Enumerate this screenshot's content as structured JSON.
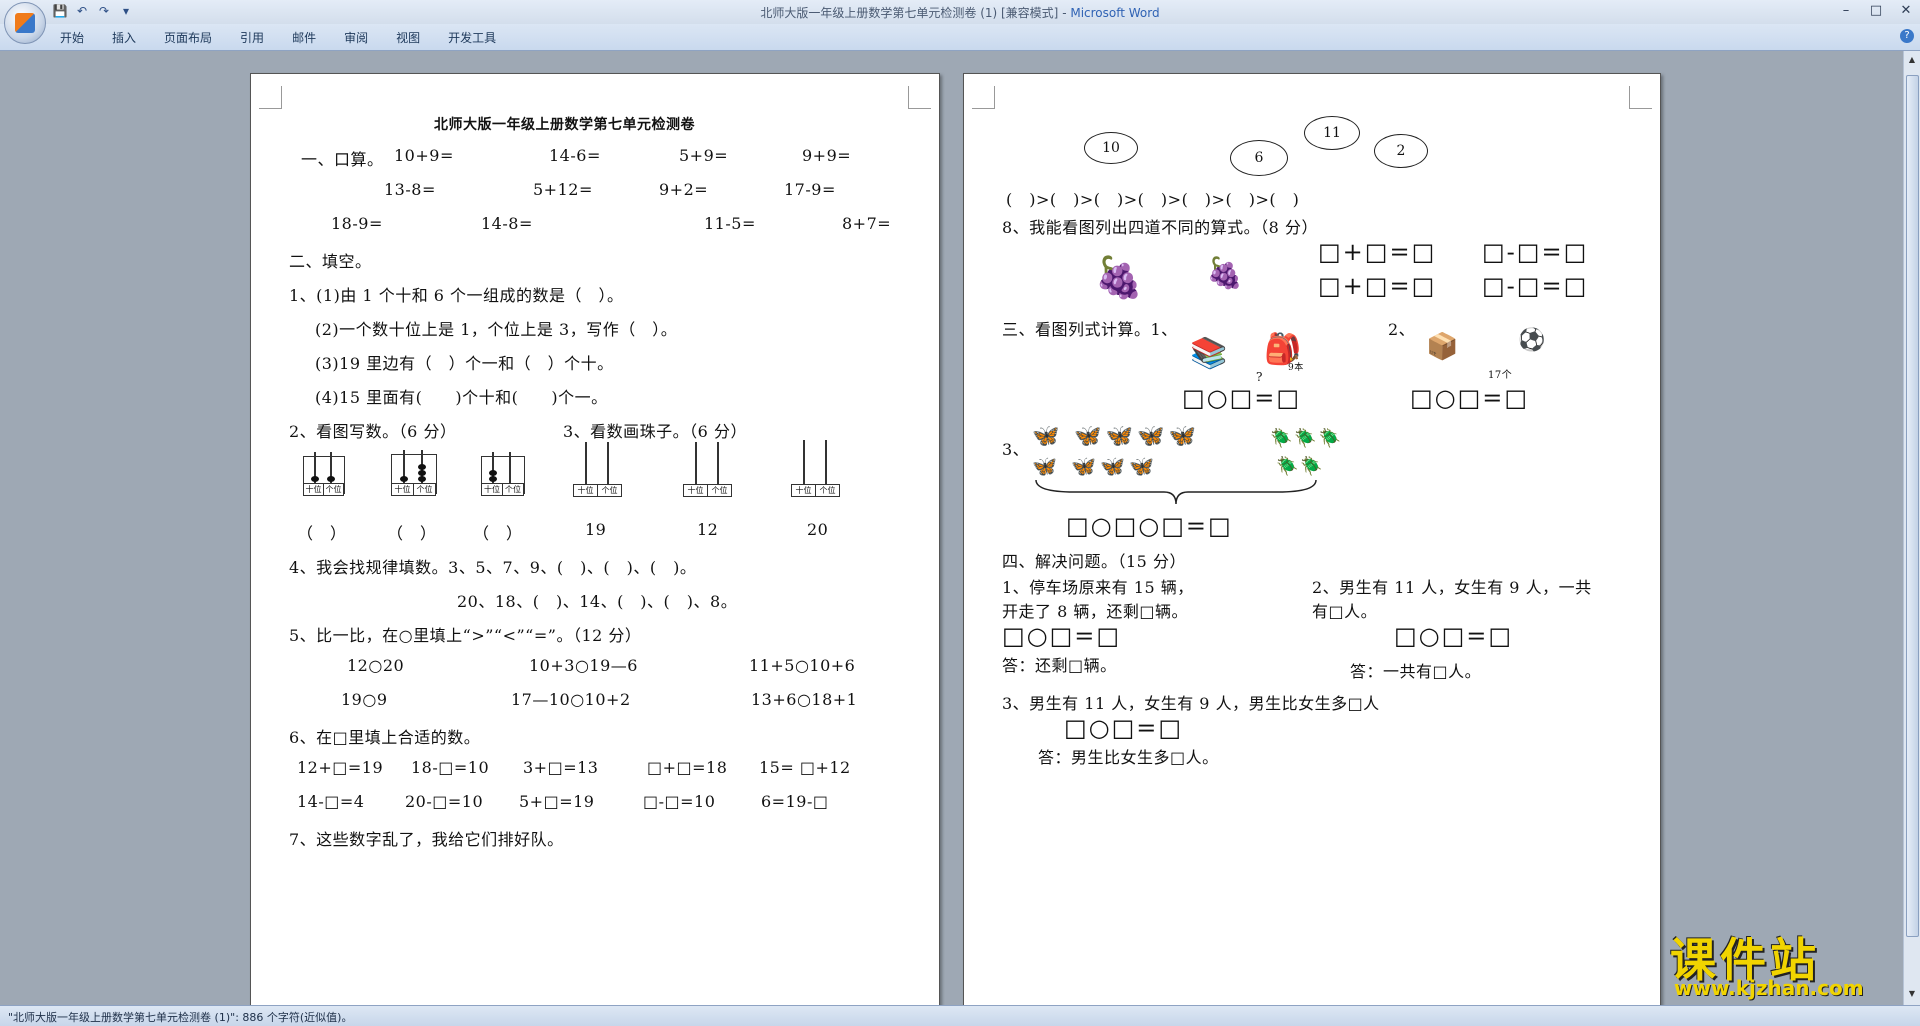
{
  "window": {
    "title": "北师大版一年级上册数学第七单元检测卷 (1) [兼容模式]",
    "app_name": "Microsoft Word",
    "dash": " - "
  },
  "qat": {
    "save": "💾",
    "undo": "↶",
    "redo": "↷",
    "more": "▾"
  },
  "window_controls": {
    "minimize": "–",
    "maximize": "□",
    "close": "✕"
  },
  "ribbon": {
    "tabs": [
      "开始",
      "插入",
      "页面布局",
      "引用",
      "邮件",
      "审阅",
      "视图",
      "开发工具"
    ],
    "help": "?"
  },
  "page1": {
    "title": "北师大版一年级上册数学第七单元检测卷",
    "s1_head": "一、口算。",
    "s1_row1": [
      "10+9=",
      "14-6=",
      "5+9=",
      "9+9="
    ],
    "s1_row2": [
      "13-8=",
      "5+12=",
      "9+2=",
      "17-9="
    ],
    "s1_row3": [
      "18-9=",
      "14-8=",
      "11-5=",
      "8+7="
    ],
    "s2_head": "二、填空。",
    "q1_1": "1、(1)由 1 个十和 6 个一组成的数是（　）。",
    "q1_2": "(2)一个数十位上是 1，个位上是 3，写作（　）。",
    "q1_3": "(3)19 里边有（　）个一和（　）个十。",
    "q1_4": "(4)15 里面有(　　)个十和(　　)个一。",
    "q2": "2、看图写数。（6 分）",
    "q3": "3、看数画珠子。（6 分）",
    "abacus_place_tens": "十位",
    "abacus_place_ones": "个位",
    "abacus_answers": [
      "（　）",
      "（　）",
      "（　）",
      "19",
      "12",
      "20"
    ],
    "q4_1": "4、我会找规律填数。3、5、7、9、(　)、(　)、(　)。",
    "q4_2": "20、18、(　)、14、(　)、(　)、8。",
    "q5": "5、比一比，在○里填上“>”“<”“=”。（12 分）",
    "q5_row1": [
      "12○20",
      "10+3○19—6",
      "11+5○10+6"
    ],
    "q5_row2": [
      "19○9",
      "17—10○10+2",
      "13+6○18+1"
    ],
    "q6": "6、在□里填上合适的数。",
    "q6_row1": [
      "12+□=19",
      "18-□=10",
      "3+□=13",
      "□+□=18",
      "15= □+12"
    ],
    "q6_row2": [
      "14-□=4",
      "20-□=10",
      "5+□=19",
      "□-□=10",
      "6=19-□"
    ],
    "q7": "7、这些数字乱了，我给它们排好队。"
  },
  "page2": {
    "clouds": [
      "10",
      "6",
      "11",
      "2"
    ],
    "order_row": "(　)>(　)>(　)>(　)>(　)>(　)>(　)",
    "q8": "8、我能看图列出四道不同的算式。（8 分）",
    "eq_add": "□+□=□",
    "eq_sub": "□-□=□",
    "s3": "三、看图列式计算。1、",
    "s3_2": "2、",
    "s3_q": "?",
    "box_9": "9本",
    "box_17": "17个",
    "eq_blank": "□○□=□",
    "q3_label": "3、",
    "eq_long": "□○□○□=□",
    "s4": "四、解决问题。（15 分）",
    "p1_a": "1、停车场原来有 15 辆，",
    "p1_b": "开走了 8 辆，还剩□辆。",
    "p2_a": "2、男生有 11 人，女生有 9 人，一共",
    "p2_b": "有□人。",
    "ans1": "答：还剩□辆。",
    "ans2": "答：一共有□人。",
    "p3": "3、男生有 11 人，女生有 9 人，男生比女生多□人",
    "ans3": "答：男生比女生多□人。"
  },
  "status": {
    "text": "\"北师大版一年级上册数学第七单元检测卷 (1)\": 886 个字符(近似值)。"
  },
  "watermark": {
    "cn": "课件站",
    "url": "www.kjzhan.com"
  },
  "marks": {
    "para": "↵"
  }
}
